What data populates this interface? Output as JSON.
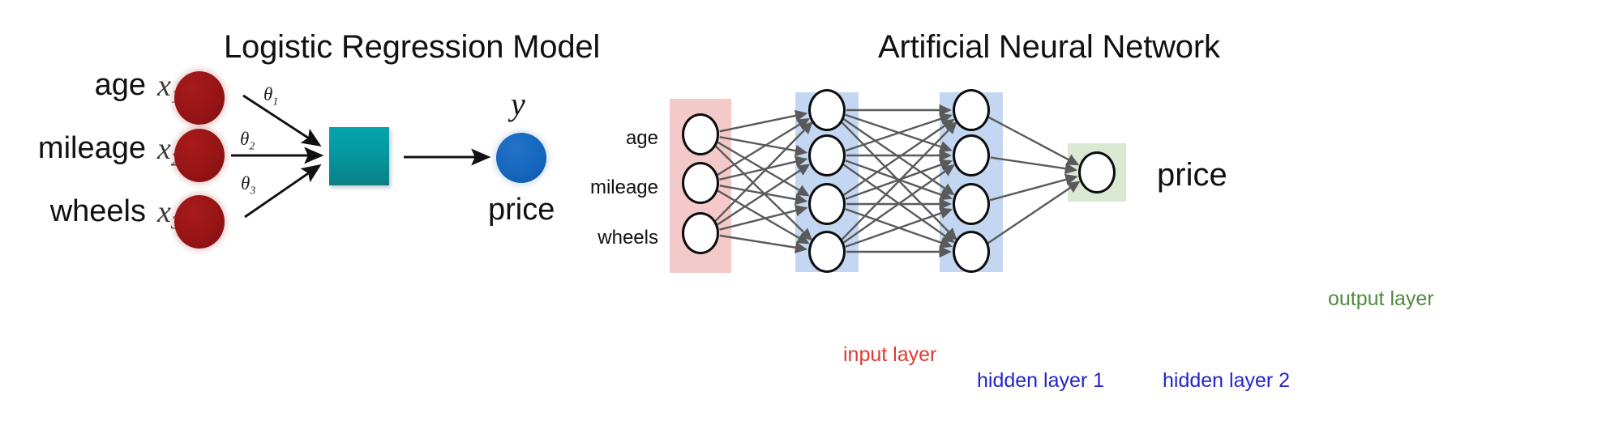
{
  "panels": {
    "left": {
      "title": "Logistic Regression Model",
      "features": [
        {
          "name": "age",
          "variable": "x",
          "subscript": "1"
        },
        {
          "name": "mileage",
          "variable": "x",
          "subscript": "2"
        },
        {
          "name": "wheels",
          "variable": "x",
          "subscript": "3"
        }
      ],
      "weights": [
        {
          "symbol": "θ",
          "subscript": "1"
        },
        {
          "symbol": "θ",
          "subscript": "2"
        },
        {
          "symbol": "θ",
          "subscript": "3"
        }
      ],
      "output_symbol": "y",
      "output_label": "price",
      "colors": {
        "input_node": "#971415",
        "sum_box_top": "#03a3ab",
        "sum_box_bottom": "#0b7f87",
        "output_node": "#1566bd"
      }
    },
    "right": {
      "title": "Artificial Neural Network",
      "input_labels": [
        "age",
        "mileage",
        "wheels"
      ],
      "output_label": "price",
      "layers": [
        {
          "id": "input",
          "caption": "input layer",
          "caption_color": "#e03a33",
          "band_color": "#f4c9c9",
          "node_count": 3
        },
        {
          "id": "hidden1",
          "caption": "hidden layer 1",
          "caption_color": "#2424c8",
          "band_color": "#c3d7f2",
          "node_count": 4
        },
        {
          "id": "hidden2",
          "caption": "hidden layer 2",
          "caption_color": "#2424c8",
          "band_color": "#c3d7f2",
          "node_count": 4
        },
        {
          "id": "output",
          "caption": "output layer",
          "caption_color": "#4f8a3c",
          "band_color": "#d9e9d2",
          "node_count": 1
        }
      ],
      "connection_color": "#5a5a5a"
    }
  },
  "diagram_data": {
    "type": "diagram",
    "background": "#ffffff",
    "arrow_color": "#111111"
  }
}
